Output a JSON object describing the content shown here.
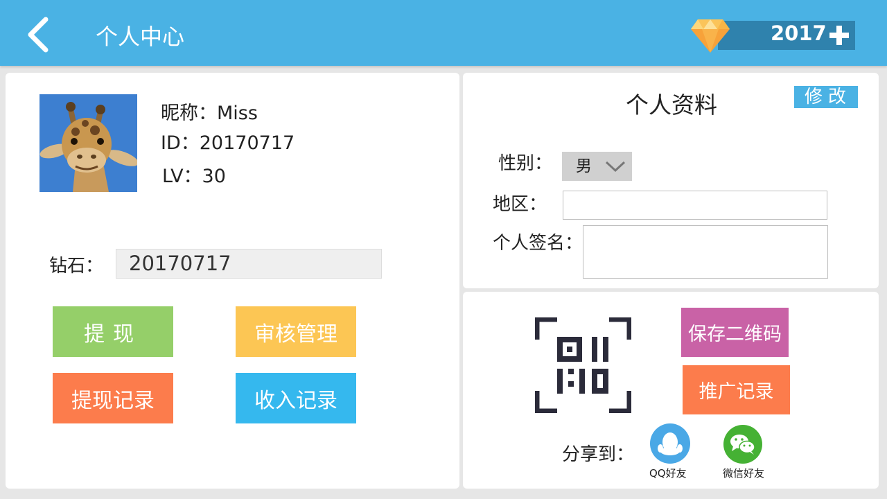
{
  "header": {
    "title": "个人中心",
    "gem_count": "2017",
    "back_icon": "chevron-left-icon",
    "gem_icon": "diamond-icon",
    "plus_icon": "plus-icon"
  },
  "profile": {
    "nickname_line": "昵称：Miss",
    "id_line": "ID：20170717",
    "level_line": "LV：30",
    "avatar_icon": "giraffe-avatar"
  },
  "diamond": {
    "label": "钻石：",
    "value": "20170717"
  },
  "actions": {
    "withdraw": "提现",
    "review": "审核管理",
    "withdraw_records": "提现记录",
    "income_records": "收入记录"
  },
  "details": {
    "title": "个人资料",
    "edit_label": "修改",
    "gender_label": "性别：",
    "gender_value": "男",
    "region_label": "地区：",
    "region_value": "",
    "signature_label": "个人签名：",
    "signature_value": ""
  },
  "share": {
    "save_qr": "保存二维码",
    "promo_records": "推广记录",
    "share_label": "分享到：",
    "qq_caption": "QQ好友",
    "wechat_caption": "微信好友"
  },
  "colors": {
    "header": "#4ab2e4",
    "withdraw": "#95cf69",
    "review": "#fcc654",
    "orange": "#fc7c4c",
    "income": "#35b8ee",
    "save_qr": "#c962a6",
    "qq": "#4aa8e6",
    "wechat": "#45b134"
  }
}
